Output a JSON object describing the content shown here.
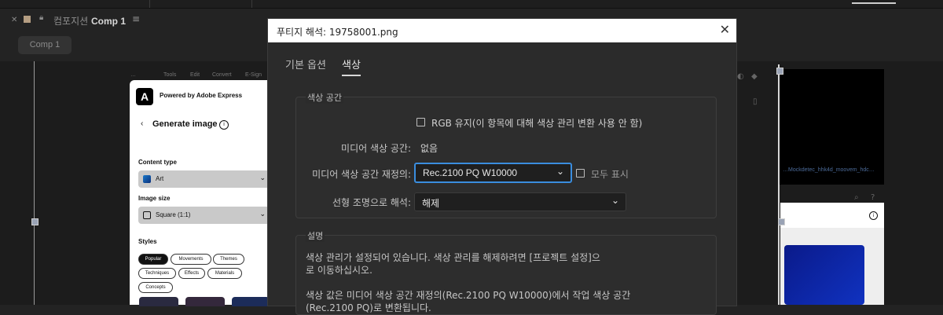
{
  "app": {
    "comp_panel_title_prefix": "컴포지션",
    "comp_name": "Comp 1",
    "comp_tab": "Comp 1",
    "close_icon": "close-icon",
    "lock_icon": "lock-icon",
    "menu_icon": "hamburger-icon",
    "label_color": "#b59e82"
  },
  "background_menu": [
    "…",
    "Tools",
    "Edit",
    "Convert",
    "E-Sign"
  ],
  "express_panel": {
    "logo": "A",
    "powered_by": "Powered by Adobe Express",
    "back_icon": "chevron-left-icon",
    "heading": "Generate image",
    "info_icon": "info-icon",
    "content_type_label": "Content type",
    "content_type_value": "Art",
    "image_size_label": "Image size",
    "image_size_value": "Square (1:1)",
    "styles_label": "Styles",
    "chips_row1": [
      "Popular",
      "Movements",
      "Themes"
    ],
    "chips_row2": [
      "Techniques",
      "Effects",
      "Materials"
    ],
    "chips_row3": [
      "Concepts"
    ]
  },
  "right_area": {
    "caption_text": "…Mockdetec_hhk4d_moovem_hdc…",
    "info_icon": "info-icon"
  },
  "dialog": {
    "title": "푸티지 해석: 19758001.png",
    "close_icon": "close-icon",
    "tabs": [
      {
        "label": "기본 옵션",
        "active": false
      },
      {
        "label": "색상",
        "active": true
      }
    ],
    "color_space_group": {
      "title": "색상 공간",
      "preserve_rgb_label": "RGB 유지(이 항목에 대해 색상 관리 변환 사용 안 함)",
      "preserve_rgb_checked": false,
      "media_color_space_label": "미디어 색상 공간:",
      "media_color_space_value": "없음",
      "override_label": "미디어 색상 공간 재정의:",
      "override_value": "Rec.2100 PQ W10000",
      "show_all_label": "모두 표시",
      "show_all_checked": false,
      "linear_label": "선형 조명으로 해석:",
      "linear_value": "해제"
    },
    "description_group": {
      "title": "설명",
      "line1": "색상 관리가 설정되어 있습니다. 색상 관리를 해제하려면 [프로젝트 설정]으",
      "line2": "로 이동하십시오.",
      "line3": "색상 값은 미디어 색상 공간 재정의(Rec.2100 PQ W10000)에서 작업 색상 공간",
      "line4": "(Rec.2100 PQ)로 변환됩니다."
    },
    "accent_color": "#3a8dde"
  }
}
